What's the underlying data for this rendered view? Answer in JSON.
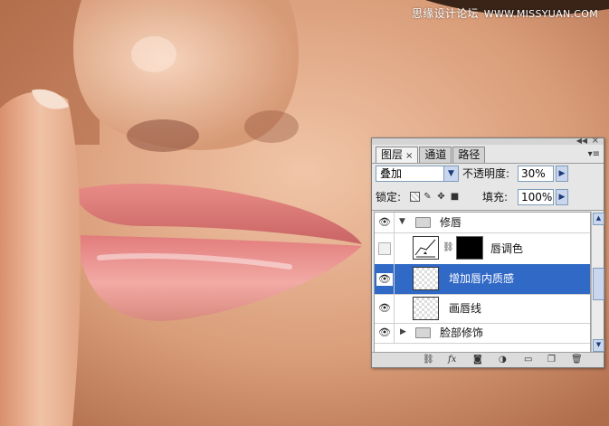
{
  "watermark": {
    "text_cn": "思缘设计论坛",
    "text_url": "WWW.MISSYUAN.COM"
  },
  "panel": {
    "tabs": [
      {
        "label": "图层",
        "close": "×"
      },
      {
        "label": "通道"
      },
      {
        "label": "路径"
      }
    ],
    "blend_mode": "叠加",
    "opacity_label": "不透明度:",
    "opacity_value": "30%",
    "lock_label": "锁定:",
    "fill_label": "填充:",
    "fill_value": "100%",
    "layers": [
      {
        "name": "修唇",
        "type": "group",
        "expanded": true,
        "visible": true
      },
      {
        "name": "唇调色",
        "type": "adjustment",
        "visible": false
      },
      {
        "name": "增加唇内质感",
        "type": "pixel",
        "visible": true,
        "selected": true
      },
      {
        "name": "画唇线",
        "type": "pixel",
        "visible": true
      },
      {
        "name": "脸部修饰",
        "type": "group",
        "expanded": false,
        "visible": true
      }
    ],
    "bottom_icons": [
      "link-icon",
      "fx-icon",
      "mask-icon",
      "adjustment-icon",
      "folder-icon",
      "new-layer-icon",
      "trash-icon"
    ],
    "fx_label": "fx",
    "colors": {
      "selection": "#3169c6",
      "panel_bg": "#e6e6e6"
    }
  }
}
